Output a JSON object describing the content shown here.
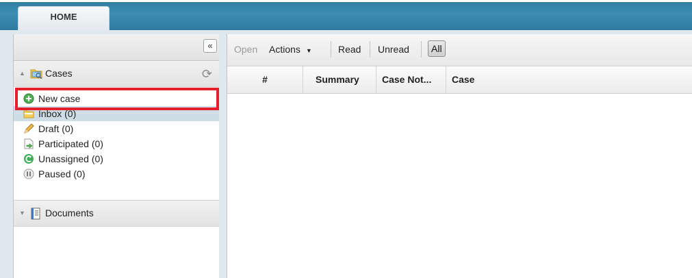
{
  "header": {
    "home_tab": "HOME"
  },
  "sidebar": {
    "collapse_glyph": "«",
    "cases": {
      "label": "Cases",
      "items": [
        {
          "label": "New case",
          "icon": "add-circle-icon"
        },
        {
          "label": "Inbox (0)",
          "icon": "inbox-icon"
        },
        {
          "label": "Draft (0)",
          "icon": "pencil-icon"
        },
        {
          "label": "Participated (0)",
          "icon": "participated-icon"
        },
        {
          "label": "Unassigned (0)",
          "icon": "unassigned-icon"
        },
        {
          "label": "Paused (0)",
          "icon": "pause-icon"
        }
      ]
    },
    "documents": {
      "label": "Documents"
    }
  },
  "toolbar": {
    "open": "Open",
    "actions": "Actions",
    "read": "Read",
    "unread": "Unread",
    "all": "All"
  },
  "grid": {
    "columns": [
      "#",
      "Summary",
      "Case Not...",
      "Case"
    ]
  },
  "colors": {
    "topbar": "#2f7ea4",
    "highlight": "#e4202b",
    "selected_row": "#cfdde6"
  }
}
